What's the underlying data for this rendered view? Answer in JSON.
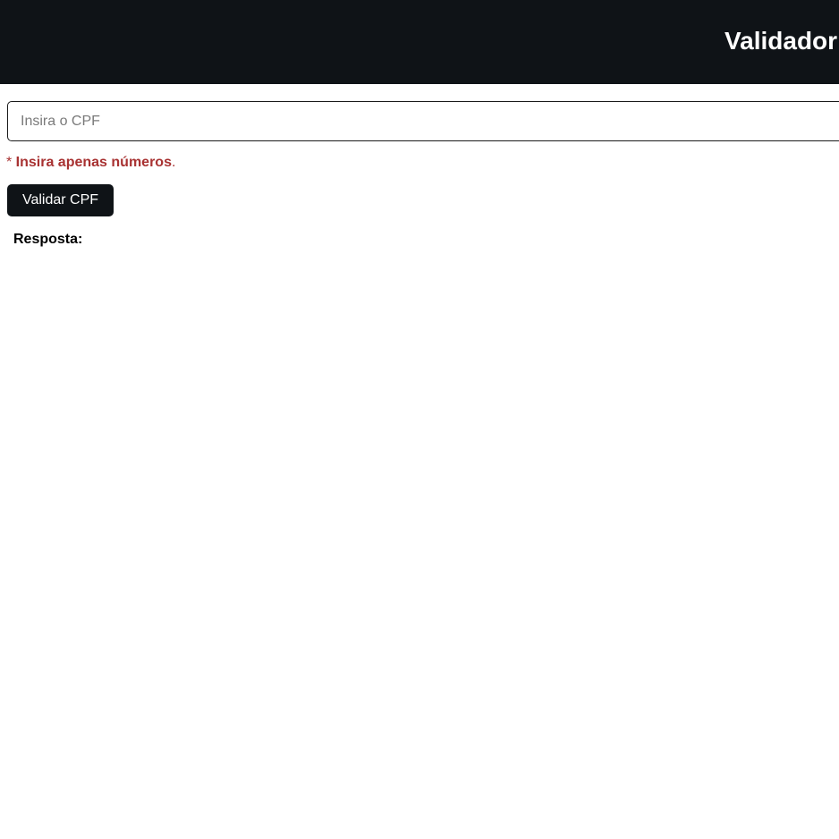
{
  "header": {
    "title": "Validador"
  },
  "form": {
    "cpf_placeholder": "Insira o CPF",
    "cpf_value": "",
    "hint_asterisk": "* ",
    "hint_text": "Insira apenas números",
    "hint_period": ".",
    "validate_label": "Validar CPF"
  },
  "response": {
    "label": "Resposta:",
    "value": ""
  },
  "colors": {
    "header_bg": "#0f1317",
    "button_bg": "#0f1317",
    "hint_color": "#a83232"
  }
}
